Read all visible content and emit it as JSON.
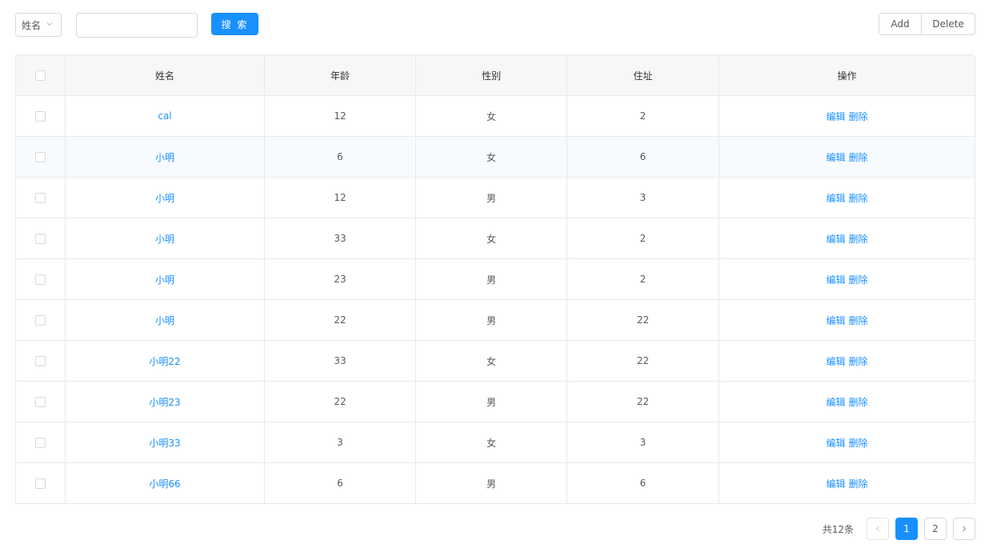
{
  "toolbar": {
    "select_value": "姓名",
    "search_value": "",
    "search_placeholder": "",
    "search_button": "搜 索",
    "add_button": "Add",
    "delete_button": "Delete"
  },
  "table": {
    "headers": [
      "姓名",
      "年龄",
      "性别",
      "住址",
      "操作"
    ],
    "rows": [
      {
        "name": "cal",
        "age": "12",
        "gender": "女",
        "address": "2"
      },
      {
        "name": "小明",
        "age": "6",
        "gender": "女",
        "address": "6"
      },
      {
        "name": "小明",
        "age": "12",
        "gender": "男",
        "address": "3"
      },
      {
        "name": "小明",
        "age": "33",
        "gender": "女",
        "address": "2"
      },
      {
        "name": "小明",
        "age": "23",
        "gender": "男",
        "address": "2"
      },
      {
        "name": "小明",
        "age": "22",
        "gender": "男",
        "address": "22"
      },
      {
        "name": "小明22",
        "age": "33",
        "gender": "女",
        "address": "22"
      },
      {
        "name": "小明23",
        "age": "22",
        "gender": "男",
        "address": "22"
      },
      {
        "name": "小明33",
        "age": "3",
        "gender": "女",
        "address": "3"
      },
      {
        "name": "小明66",
        "age": "6",
        "gender": "男",
        "address": "6"
      }
    ],
    "edit_label": "编辑",
    "delete_label": "删除"
  },
  "pagination": {
    "total_text": "共12条",
    "pages": [
      "1",
      "2"
    ],
    "current": "1"
  },
  "colors": {
    "primary": "#1890ff",
    "border": "#e8e8e8",
    "header_bg": "#f7f7f7",
    "hover_row_bg": "#f7fbff"
  },
  "icons": {
    "select_arrow": "chevron-down-icon",
    "prev": "chevron-left-icon",
    "next": "chevron-right-icon"
  }
}
